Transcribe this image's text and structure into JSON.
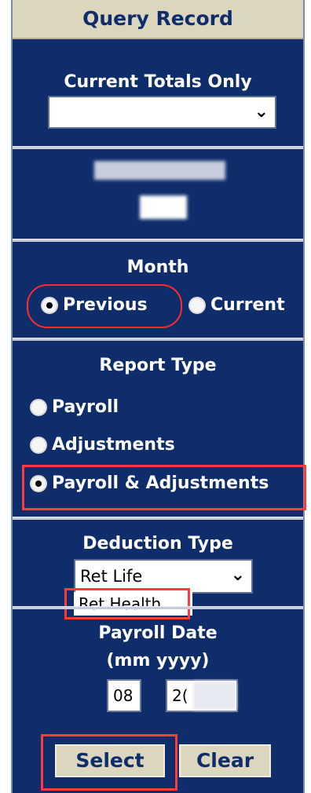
{
  "panel": {
    "title": "Query Record"
  },
  "current_totals": {
    "label": "Current Totals Only",
    "selected": ""
  },
  "employee": {
    "label": "Employee ID"
  },
  "month": {
    "label": "Month",
    "options": [
      "Previous",
      "Current"
    ],
    "selected": "Previous"
  },
  "report_type": {
    "label": "Report Type",
    "options": [
      "Payroll",
      "Adjustments",
      "Payroll & Adjustments"
    ],
    "selected": "Payroll & Adjustments"
  },
  "deduction_type": {
    "label": "Deduction Type",
    "selected": "Ret Life",
    "highlighted_option": "Ret Health"
  },
  "payroll_date": {
    "label": "Payroll Date",
    "format": "(mm yyyy)",
    "month_value": "08",
    "year_value": "2("
  },
  "buttons": {
    "select": "Select",
    "clear": "Clear"
  },
  "colors": {
    "panel_bg": "#0f2d6b",
    "header_bg": "#ddd6bf",
    "annotation": "#ff3b3b"
  },
  "icons": {
    "dropdown": "chevron-down-icon",
    "radio": "radio-icon"
  }
}
